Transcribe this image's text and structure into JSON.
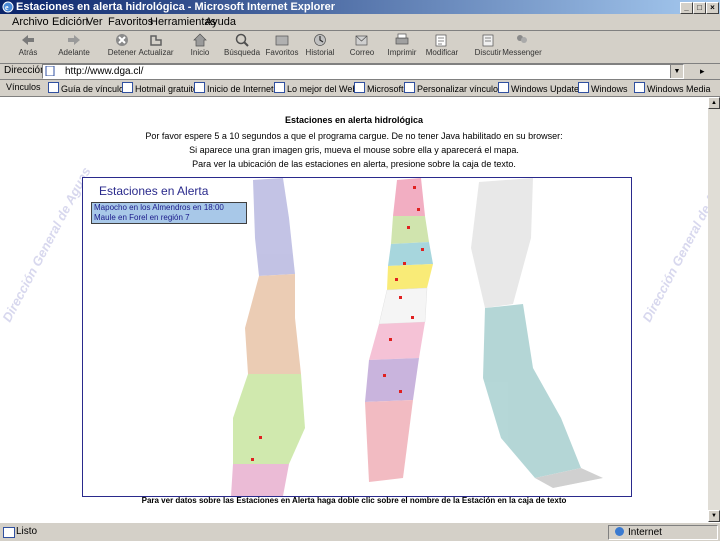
{
  "window": {
    "title": "Estaciones en alerta hidrológica - Microsoft Internet Explorer"
  },
  "menu": [
    "Archivo",
    "Edición",
    "Ver",
    "Favoritos",
    "Herramientas",
    "Ayuda"
  ],
  "toolbar": [
    {
      "label": "Atrás",
      "icon": "back-arrow-icon"
    },
    {
      "label": "Adelante",
      "icon": "forward-arrow-icon"
    },
    {
      "label": "Detener",
      "icon": "stop-icon"
    },
    {
      "label": "Actualizar",
      "icon": "refresh-icon"
    },
    {
      "label": "Inicio",
      "icon": "home-icon"
    },
    {
      "label": "Búsqueda",
      "icon": "search-icon"
    },
    {
      "label": "Favoritos",
      "icon": "favorites-icon"
    },
    {
      "label": "Historial",
      "icon": "history-icon"
    },
    {
      "label": "Correo",
      "icon": "mail-icon"
    },
    {
      "label": "Imprimir",
      "icon": "print-icon"
    },
    {
      "label": "Modificar",
      "icon": "edit-icon"
    },
    {
      "label": "Discutir",
      "icon": "discuss-icon"
    },
    {
      "label": "Messenger",
      "icon": "messenger-icon"
    }
  ],
  "address": {
    "label": "Dirección",
    "url": "http://www.dga.cl/"
  },
  "links": [
    "Vínculos",
    "Guía de vínculos",
    "Hotmail gratuito",
    "Inicio de Internet",
    "Lo mejor del Web",
    "Microsoft",
    "Personalizar vínculos",
    "Windows Update",
    "Windows",
    "Windows Media"
  ],
  "page": {
    "heading": "Estaciones en alerta hidrológica",
    "line1": "Por favor espere 5 a 10 segundos a que el programa cargue. De no tener Java habilitado en su browser:",
    "line2": "Si aparece una gran imagen gris, mueva el mouse sobre ella y aparecerá el mapa.",
    "line3": "Para ver la ubicación de las estaciones en alerta, presione sobre la caja de texto.",
    "panel_title": "Estaciones en Alerta",
    "stations": [
      "Mapocho en los Almendros en 18:00",
      "Maule en Forel en región 7"
    ],
    "footer": "Para ver datos sobre las Estaciones en Alerta haga doble clic sobre el nombre de la Estación en la caja de texto",
    "watermark": "Dirección General de Aguas"
  },
  "status": {
    "text": "Listo",
    "zone": "Internet"
  }
}
